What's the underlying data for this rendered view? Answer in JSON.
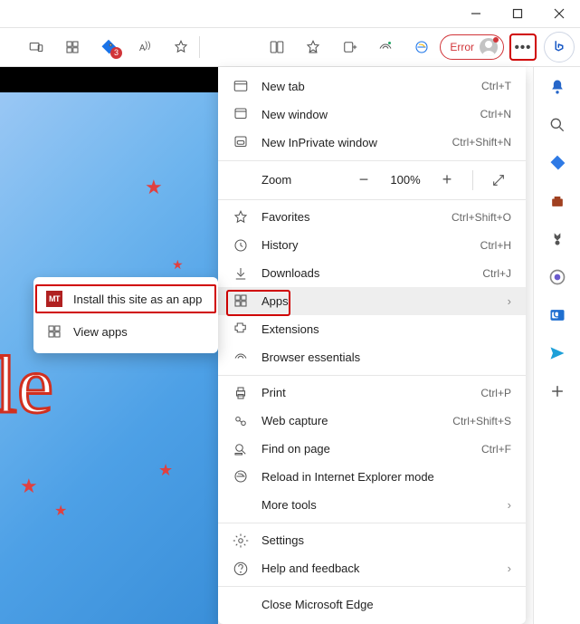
{
  "window_controls": {
    "minimize": "min",
    "maximize": "max",
    "close": "close"
  },
  "toolbar": {
    "badge_count": "3",
    "error_label": "Error",
    "more_label": "•••"
  },
  "zoom": {
    "label": "Zoom",
    "value": "100%"
  },
  "menu": {
    "new_tab": {
      "label": "New tab",
      "shortcut": "Ctrl+T"
    },
    "new_window": {
      "label": "New window",
      "shortcut": "Ctrl+N"
    },
    "new_inprivate": {
      "label": "New InPrivate window",
      "shortcut": "Ctrl+Shift+N"
    },
    "favorites": {
      "label": "Favorites",
      "shortcut": "Ctrl+Shift+O"
    },
    "history": {
      "label": "History",
      "shortcut": "Ctrl+H"
    },
    "downloads": {
      "label": "Downloads",
      "shortcut": "Ctrl+J"
    },
    "apps": {
      "label": "Apps"
    },
    "extensions": {
      "label": "Extensions"
    },
    "essentials": {
      "label": "Browser essentials"
    },
    "print": {
      "label": "Print",
      "shortcut": "Ctrl+P"
    },
    "capture": {
      "label": "Web capture",
      "shortcut": "Ctrl+Shift+S"
    },
    "find": {
      "label": "Find on page",
      "shortcut": "Ctrl+F"
    },
    "ie_mode": {
      "label": "Reload in Internet Explorer mode"
    },
    "more_tools": {
      "label": "More tools"
    },
    "settings": {
      "label": "Settings"
    },
    "help": {
      "label": "Help and feedback"
    },
    "close_edge": {
      "label": "Close Microsoft Edge"
    }
  },
  "submenu": {
    "install": "Install this site as an app",
    "view_apps": "View apps",
    "mt_badge": "MT"
  },
  "bg_text": "le"
}
